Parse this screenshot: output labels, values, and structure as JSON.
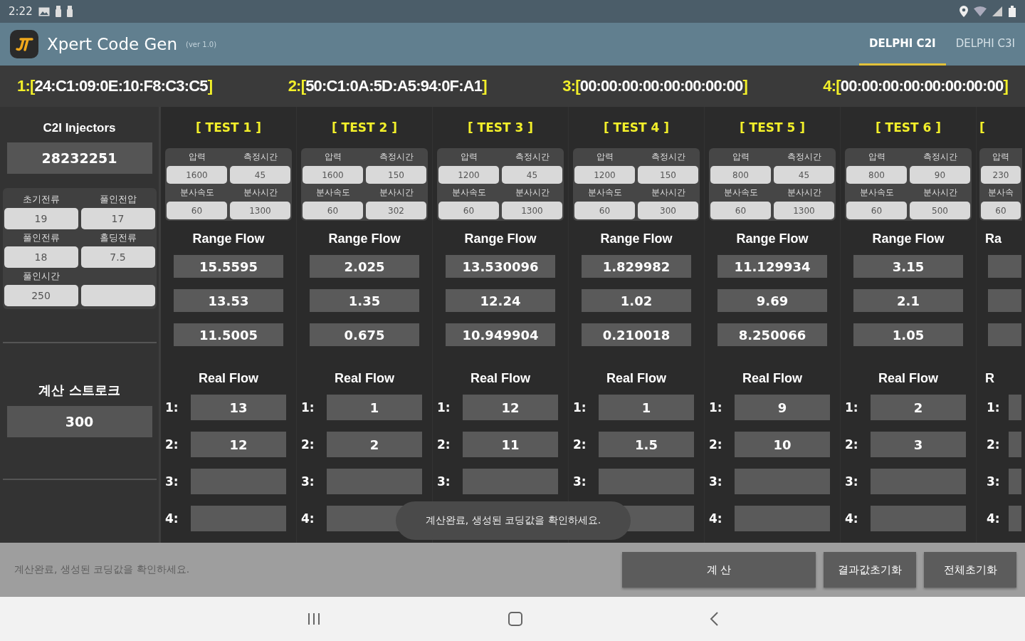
{
  "status_bar": {
    "time": "2:22"
  },
  "app_bar": {
    "title": "Xpert Code Gen",
    "version": "(ver 1.0)",
    "tabs": [
      {
        "label": "DELPHI C2I",
        "selected": true
      },
      {
        "label": "DELPHI C3I",
        "selected": false
      }
    ]
  },
  "codes": [
    {
      "open": "1:[",
      "value": "24:C1:09:0E:10:F8:C3:C5",
      "close": "]"
    },
    {
      "open": "2:[",
      "value": "50:C1:0A:5D:A5:94:0F:A1",
      "close": "]"
    },
    {
      "open": "3:[",
      "value": "00:00:00:00:00:00:00:00",
      "close": "]"
    },
    {
      "open": "4:[",
      "value": "00:00:00:00:00:00:00:00",
      "close": "]"
    }
  ],
  "injector": {
    "title": "C2I Injectors",
    "serial": "28232251",
    "params": [
      {
        "kind": "field",
        "label": "초기전류",
        "value": "19"
      },
      {
        "kind": "field",
        "label": "풀인전압",
        "value": "17"
      },
      {
        "kind": "field",
        "label": "풀인전류",
        "value": "18"
      },
      {
        "kind": "field",
        "label": "홀딩전류",
        "value": "7.5"
      },
      {
        "kind": "field",
        "label": "풀인시간",
        "value": "250"
      },
      {
        "kind": "blank"
      }
    ],
    "stroke_label": "계산 스트로크",
    "stroke_value": "300"
  },
  "tests": [
    {
      "kind": "full",
      "title": "[ TEST 1 ]",
      "params": [
        {
          "label": "압력",
          "value": "1600"
        },
        {
          "label": "측정시간",
          "value": "45"
        },
        {
          "label": "분사속도",
          "value": "60"
        },
        {
          "label": "분사시간",
          "value": "1300"
        }
      ],
      "range_title": "Range Flow",
      "range_values": [
        "15.5595",
        "13.53",
        "11.5005"
      ],
      "real_title": "Real Flow",
      "real": [
        {
          "label": "1:",
          "value": "13"
        },
        {
          "label": "2:",
          "value": "12"
        },
        {
          "label": "3:"
        },
        {
          "label": "4:"
        }
      ]
    },
    {
      "kind": "full",
      "title": "[ TEST 2 ]",
      "params": [
        {
          "label": "압력",
          "value": "1600"
        },
        {
          "label": "측정시간",
          "value": "150"
        },
        {
          "label": "분사속도",
          "value": "60"
        },
        {
          "label": "분사시간",
          "value": "302"
        }
      ],
      "range_title": "Range Flow",
      "range_values": [
        "2.025",
        "1.35",
        "0.675"
      ],
      "real_title": "Real Flow",
      "real": [
        {
          "label": "1:",
          "value": "1"
        },
        {
          "label": "2:",
          "value": "2"
        },
        {
          "label": "3:"
        },
        {
          "label": "4:"
        }
      ]
    },
    {
      "kind": "full",
      "title": "[ TEST 3 ]",
      "params": [
        {
          "label": "압력",
          "value": "1200"
        },
        {
          "label": "측정시간",
          "value": "45"
        },
        {
          "label": "분사속도",
          "value": "60"
        },
        {
          "label": "분사시간",
          "value": "1300"
        }
      ],
      "range_title": "Range Flow",
      "range_values": [
        "13.530096",
        "12.24",
        "10.949904"
      ],
      "real_title": "Real Flow",
      "real": [
        {
          "label": "1:",
          "value": "12"
        },
        {
          "label": "2:",
          "value": "11"
        },
        {
          "label": "3:"
        }
      ]
    },
    {
      "kind": "full",
      "title": "[ TEST 4 ]",
      "params": [
        {
          "label": "압력",
          "value": "1200"
        },
        {
          "label": "측정시간",
          "value": "150"
        },
        {
          "label": "분사속도",
          "value": "60"
        },
        {
          "label": "분사시간",
          "value": "300"
        }
      ],
      "range_title": "Range Flow",
      "range_values": [
        "1.829982",
        "1.02",
        "0.210018"
      ],
      "real_title": "Real Flow",
      "real": [
        {
          "label": "1:",
          "value": "1"
        },
        {
          "label": "2:",
          "value": "1.5"
        },
        {
          "label": "3:"
        }
      ]
    },
    {
      "kind": "full",
      "title": "[ TEST 5 ]",
      "params": [
        {
          "label": "압력",
          "value": "800"
        },
        {
          "label": "측정시간",
          "value": "45"
        },
        {
          "label": "분사속도",
          "value": "60"
        },
        {
          "label": "분사시간",
          "value": "1300"
        }
      ],
      "range_title": "Range Flow",
      "range_values": [
        "11.129934",
        "9.69",
        "8.250066"
      ],
      "real_title": "Real Flow",
      "real": [
        {
          "label": "1:",
          "value": "9"
        },
        {
          "label": "2:",
          "value": "10"
        },
        {
          "label": "3:"
        },
        {
          "label": "4:"
        }
      ]
    },
    {
      "kind": "full",
      "title": "[ TEST 6 ]",
      "params": [
        {
          "label": "압력",
          "value": "800"
        },
        {
          "label": "측정시간",
          "value": "90"
        },
        {
          "label": "분사속도",
          "value": "60"
        },
        {
          "label": "분사시간",
          "value": "500"
        }
      ],
      "range_title": "Range Flow",
      "range_values": [
        "3.15",
        "2.1",
        "1.05"
      ],
      "real_title": "Real Flow",
      "real": [
        {
          "label": "1:",
          "value": "2"
        },
        {
          "label": "2:",
          "value": "3"
        },
        {
          "label": "3:"
        },
        {
          "label": "4:"
        }
      ]
    },
    {
      "kind": "partial",
      "title": "[",
      "params": [
        {
          "label": "압력",
          "value": "230"
        },
        {
          "label": "분사속",
          "value": "60"
        }
      ],
      "range_title": "Ra",
      "real_title": "R",
      "real": [
        {
          "label": "1:"
        },
        {
          "label": "2:"
        },
        {
          "label": "3:"
        },
        {
          "label": "4:"
        }
      ]
    }
  ],
  "toast": "계산완료, 생성된 코딩값을 확인하세요.",
  "footer": {
    "message": "계산완료, 생성된 코딩값을 확인하세요.",
    "buttons": [
      {
        "kind": "wide",
        "label": "계 산"
      },
      {
        "kind": "normal",
        "label": "결과값초기화"
      },
      {
        "kind": "normal",
        "label": "전체초기화"
      }
    ]
  }
}
